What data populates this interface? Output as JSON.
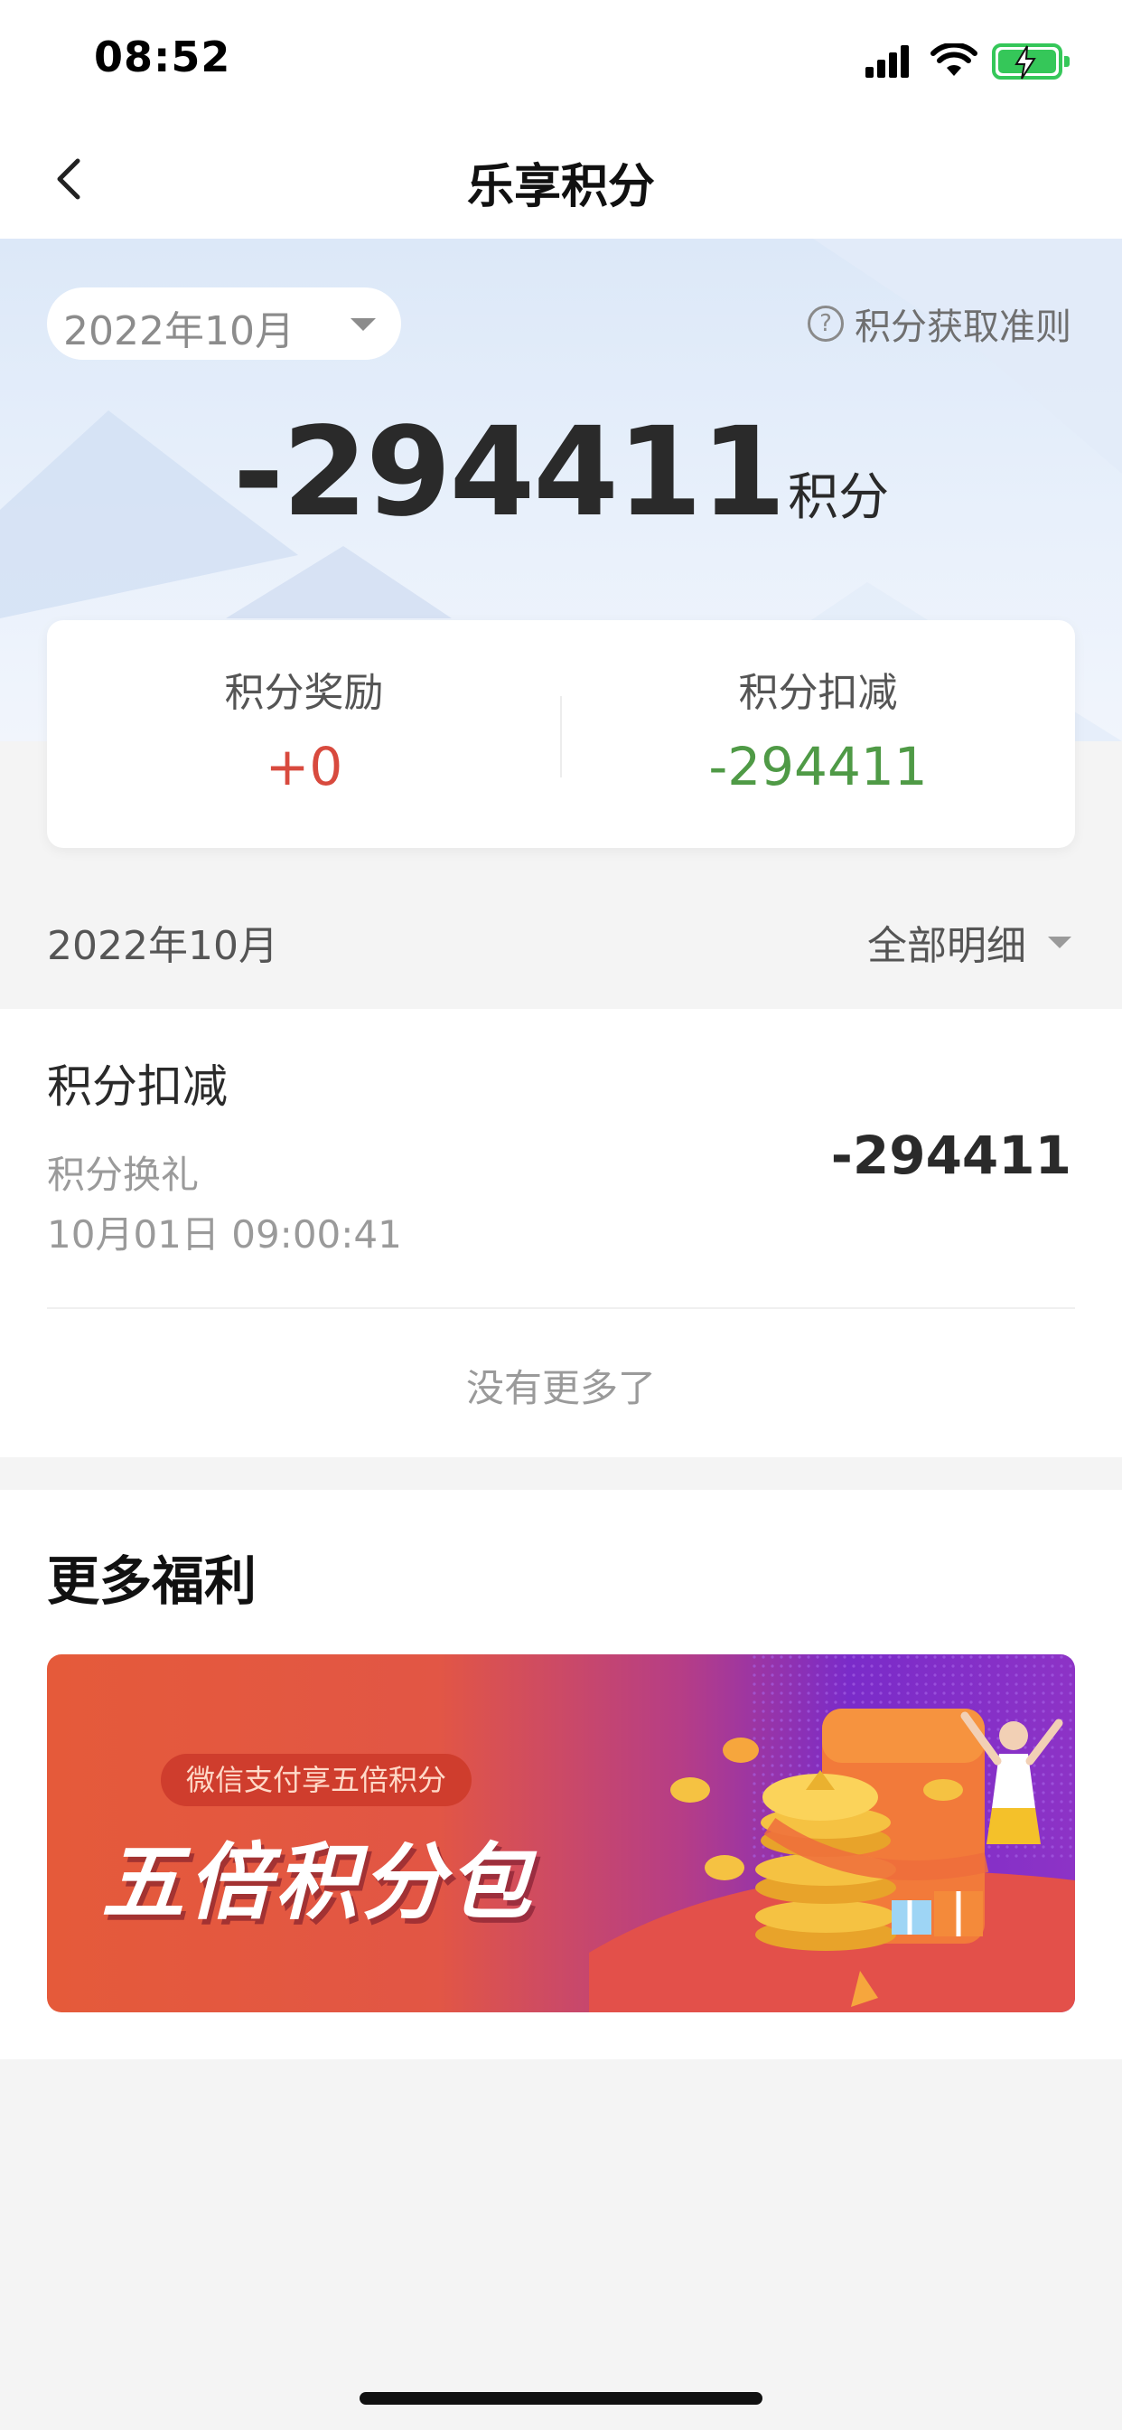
{
  "status_bar": {
    "time": "08:52"
  },
  "nav": {
    "title": "乐享积分",
    "back_icon": "chevron-left-icon"
  },
  "header": {
    "month_selector": "2022年10月",
    "rules_link": "积分获取准则",
    "rules_icon": "question-circle-icon",
    "total_points": "-294411",
    "points_unit": "积分"
  },
  "summary": {
    "reward_label": "积分奖励",
    "reward_value": "+0",
    "deduct_label": "积分扣减",
    "deduct_value": "-294411",
    "reward_color": "#d84a3e",
    "deduct_color": "#4f9a46"
  },
  "filter": {
    "month": "2022年10月",
    "type_select": "全部明细"
  },
  "transactions": [
    {
      "title": "积分扣减",
      "description": "积分换礼",
      "time": "10月01日 09:00:41",
      "amount": "-294411"
    }
  ],
  "list_end": "没有更多了",
  "benefits": {
    "title": "更多福利",
    "banner": {
      "tag": "微信支付享五倍积分",
      "headline": "五倍积分包"
    }
  }
}
